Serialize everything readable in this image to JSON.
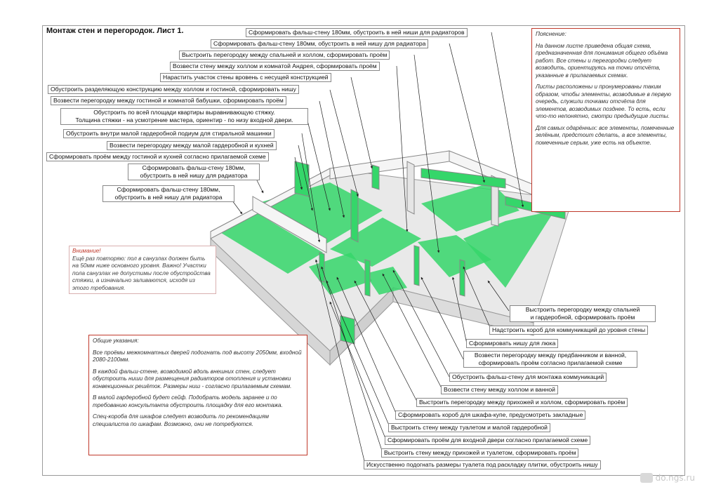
{
  "title": "Монтаж стен и перегородок. Лист 1.",
  "labels_top": [
    "Сформировать фальш-стену 180мм, обустроить в ней ниши для радиаторов",
    "Сформировать фальш-стену 180мм, обустроить в ней нишу для радиатора",
    "Выстроить перегородку между спальней и холлом, сформировать проём",
    "Возвести стену между холлом и комнатой Андрея, сформировать проём",
    "Нарастить участок стены вровень с несущей конструкцией",
    "Обустроить разделяющую конструкцию между холлом и гостиной, сформировать нишу",
    "Возвести перегородку между гостиной и комнатой бабушки, сформировать проём",
    "Обустроить по всей площади квартиры выравнивающую стяжку.",
    "Толщина стяжки - на усмотрение мастера, ориентир - по низу входной двери.",
    "Обустроить внутри малой гардеробной подиум для стиральной машинки",
    "Возвести перегородку между малой гардеробной и кухней",
    "Сформировать проём между гостиной и кухней согласно прилагаемой схеме",
    "Сформировать фальш-стену 180мм,",
    "обустроить в ней нишу для радиатора",
    "Сформировать фальш-стену 180мм,",
    "обустроить в ней нишу для радиатора"
  ],
  "labels_bottom": [
    "Выстроить перегородку между спальней",
    "и гардеробной, сформировать проём",
    "Надстроить короб для коммуникаций до уровня стены",
    "Сформировать нишу для люка",
    "Возвести перегородку между предбанником и ванной,",
    "сформировать проём согласно прилагаемой схеме",
    "Обустроить фальш-стену для монтажа коммуникаций",
    "Возвести стену между холлом и ванной",
    "Выстроить перегородку между прихожей и холлом, сформировать проём",
    "Сформировать короб для шкафа-купе, предусмотреть закладные",
    "Выстроить стену между туалетом и малой гардеробной",
    "Сформировать проём для входной двери согласно прилагаемой схеме",
    "Выстроить стену между прихожей и туалетом, сформировать проём",
    "Искусственно подогнать размеры туалета под раскладку плитки, обустроить нишу"
  ],
  "explanation": {
    "head": "Пояснение:",
    "p1": "На данном листе приведена общая схема, предназначенная для понимания общего объёма работ. Все стены и перегородки следует возводить, ориентируясь на точки отсчёта, указанные в прилагаемых схемах.",
    "p2": "Листы расположены и пронумерованы таким образом, чтобы элементы, возводимые в первую очередь, служили точками отсчёта для элементов, возводимых позднее. То есть, если что-то непонятно, смотри предыдущие листы.",
    "p3": "Для самых одарённых: все элементы, помеченные зелёным, предстоит сделать, а все элементы, помеченные серым, уже есть на объекте."
  },
  "attention": {
    "head": "Внимание!",
    "body": "Ещё раз повторяю: пол в санузлах должен быть на 50мм ниже основного уровня. Важно! Участки пола санузлах не допустимы после обустройства стяжки, а изначально заливаются, исходя из этого требования."
  },
  "general": {
    "head": "Общие указания:",
    "p1": "Все проёмы межкомнатных дверей подогнать под высоту 2050мм, входной 2080-2100мм.",
    "p2": "В каждой фальш-стене, возводимой вдоль внешних стен, следует обустроить ниши для размещения радиаторов отопления и установки конвекционных решёток. Размеры ниш - согласно прилагаемым схемам.",
    "p3": "В малой гардеробной будет сейф. Подобрать модель заранее и по требованию консультанта обустроить площадку для его монтажа.",
    "p4": "Спец-короба для шкафов следует возводить по рекомендациям специалиста по шкафам. Возможно, они не потребуются."
  },
  "watermark": "do.ngs.ru",
  "colors": {
    "green": "#35d66a",
    "note_border": "#c0392b",
    "wall": "#f2f2f2"
  }
}
